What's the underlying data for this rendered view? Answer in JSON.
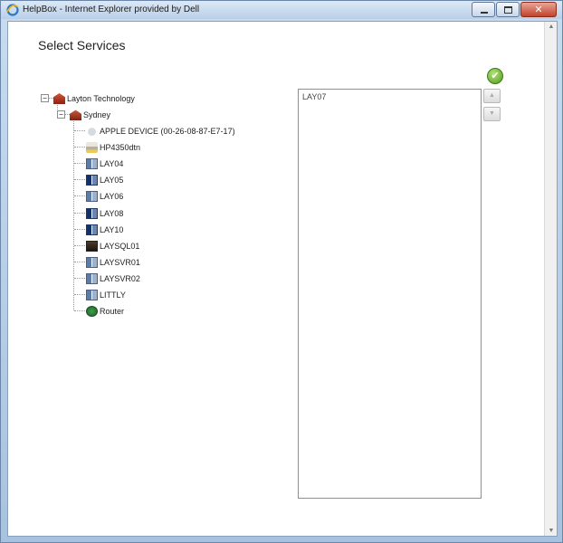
{
  "window": {
    "title": "HelpBox - Internet Explorer provided by Dell",
    "close_glyph": "✕"
  },
  "page": {
    "title": "Select Services"
  },
  "tree": {
    "root": {
      "label": "Layton Technology",
      "icon": "organization-icon",
      "expanded": true,
      "toggle": "−"
    },
    "site": {
      "label": "Sydney",
      "icon": "site-icon",
      "expanded": true,
      "toggle": "−"
    },
    "devices": [
      {
        "label": "APPLE DEVICE (00-26-08-87-E7-17)",
        "icon": "apple-device-icon"
      },
      {
        "label": "HP4350dtn",
        "icon": "printer-icon"
      },
      {
        "label": "LAY04",
        "icon": "computer-icon"
      },
      {
        "label": "LAY05",
        "icon": "computer-dark-icon"
      },
      {
        "label": "LAY06",
        "icon": "computer-icon"
      },
      {
        "label": "LAY08",
        "icon": "computer-dark-icon"
      },
      {
        "label": "LAY10",
        "icon": "computer-dark-icon"
      },
      {
        "label": "LAYSQL01",
        "icon": "server-icon"
      },
      {
        "label": "LAYSVR01",
        "icon": "computer-icon"
      },
      {
        "label": "LAYSVR02",
        "icon": "computer-icon"
      },
      {
        "label": "LITTLY",
        "icon": "computer-icon"
      },
      {
        "label": "Router",
        "icon": "router-icon"
      }
    ]
  },
  "selected_list": {
    "items": [
      "LAY07"
    ]
  },
  "controls": {
    "ok_glyph": "✔",
    "move_up_glyph": "▲",
    "move_down_glyph": "▼",
    "scroll_up_glyph": "▲",
    "scroll_down_glyph": "▼"
  },
  "colors": {
    "ok_green": "#5aa826",
    "tree_org_red": "#b3361f"
  }
}
